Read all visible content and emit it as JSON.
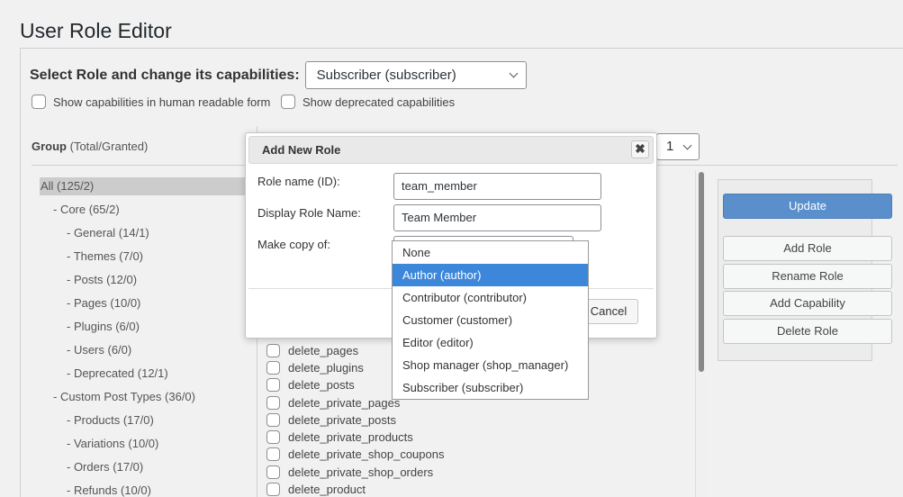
{
  "page_title": "User Role Editor",
  "role_select": {
    "label": "Select Role and change its capabilities:",
    "value": "Subscriber (subscriber)"
  },
  "checkboxes": {
    "human_readable": "Show capabilities in human readable form",
    "deprecated": "Show deprecated capabilities"
  },
  "group_header": {
    "label": "Group",
    "sub": "(Total/Granted)"
  },
  "columns_select": "1",
  "groups": [
    {
      "label": "All (125/2)",
      "level": 0
    },
    {
      "label": "- Core (65/2)",
      "level": 1
    },
    {
      "label": "- General (14/1)",
      "level": 2
    },
    {
      "label": "- Themes (7/0)",
      "level": 2
    },
    {
      "label": "- Posts (12/0)",
      "level": 2
    },
    {
      "label": "- Pages (10/0)",
      "level": 2
    },
    {
      "label": "- Plugins (6/0)",
      "level": 2
    },
    {
      "label": "- Users (6/0)",
      "level": 2
    },
    {
      "label": "- Deprecated (12/1)",
      "level": 2
    },
    {
      "label": "- Custom Post Types (36/0)",
      "level": 1
    },
    {
      "label": "- Products (17/0)",
      "level": 2
    },
    {
      "label": "- Variations (10/0)",
      "level": 2
    },
    {
      "label": "- Orders (17/0)",
      "level": 2
    },
    {
      "label": "- Refunds (10/0)",
      "level": 2
    }
  ],
  "capabilities": [
    "delete_pages",
    "delete_plugins",
    "delete_posts",
    "delete_private_pages",
    "delete_private_posts",
    "delete_private_products",
    "delete_private_shop_coupons",
    "delete_private_shop_orders",
    "delete_product"
  ],
  "actions": {
    "update": "Update",
    "add_role": "Add Role",
    "rename_role": "Rename Role",
    "add_capability": "Add Capability",
    "delete_role": "Delete Role"
  },
  "dialog": {
    "title": "Add New Role",
    "close": "✖",
    "role_name_label": "Role name (ID):",
    "role_name_value": "team_member",
    "display_name_label": "Display Role Name:",
    "display_name_value": "Team Member",
    "copy_label": "Make copy of:",
    "cancel": "Cancel"
  },
  "copy_options": [
    "None",
    "Author (author)",
    "Contributor (contributor)",
    "Customer (customer)",
    "Editor (editor)",
    "Shop manager (shop_manager)",
    "Subscriber (subscriber)"
  ],
  "copy_highlighted_index": 1,
  "colors": {
    "primary_button": "#5b8fcc",
    "dropdown_highlight": "#3c87da",
    "selected_group": "#cccccc"
  }
}
